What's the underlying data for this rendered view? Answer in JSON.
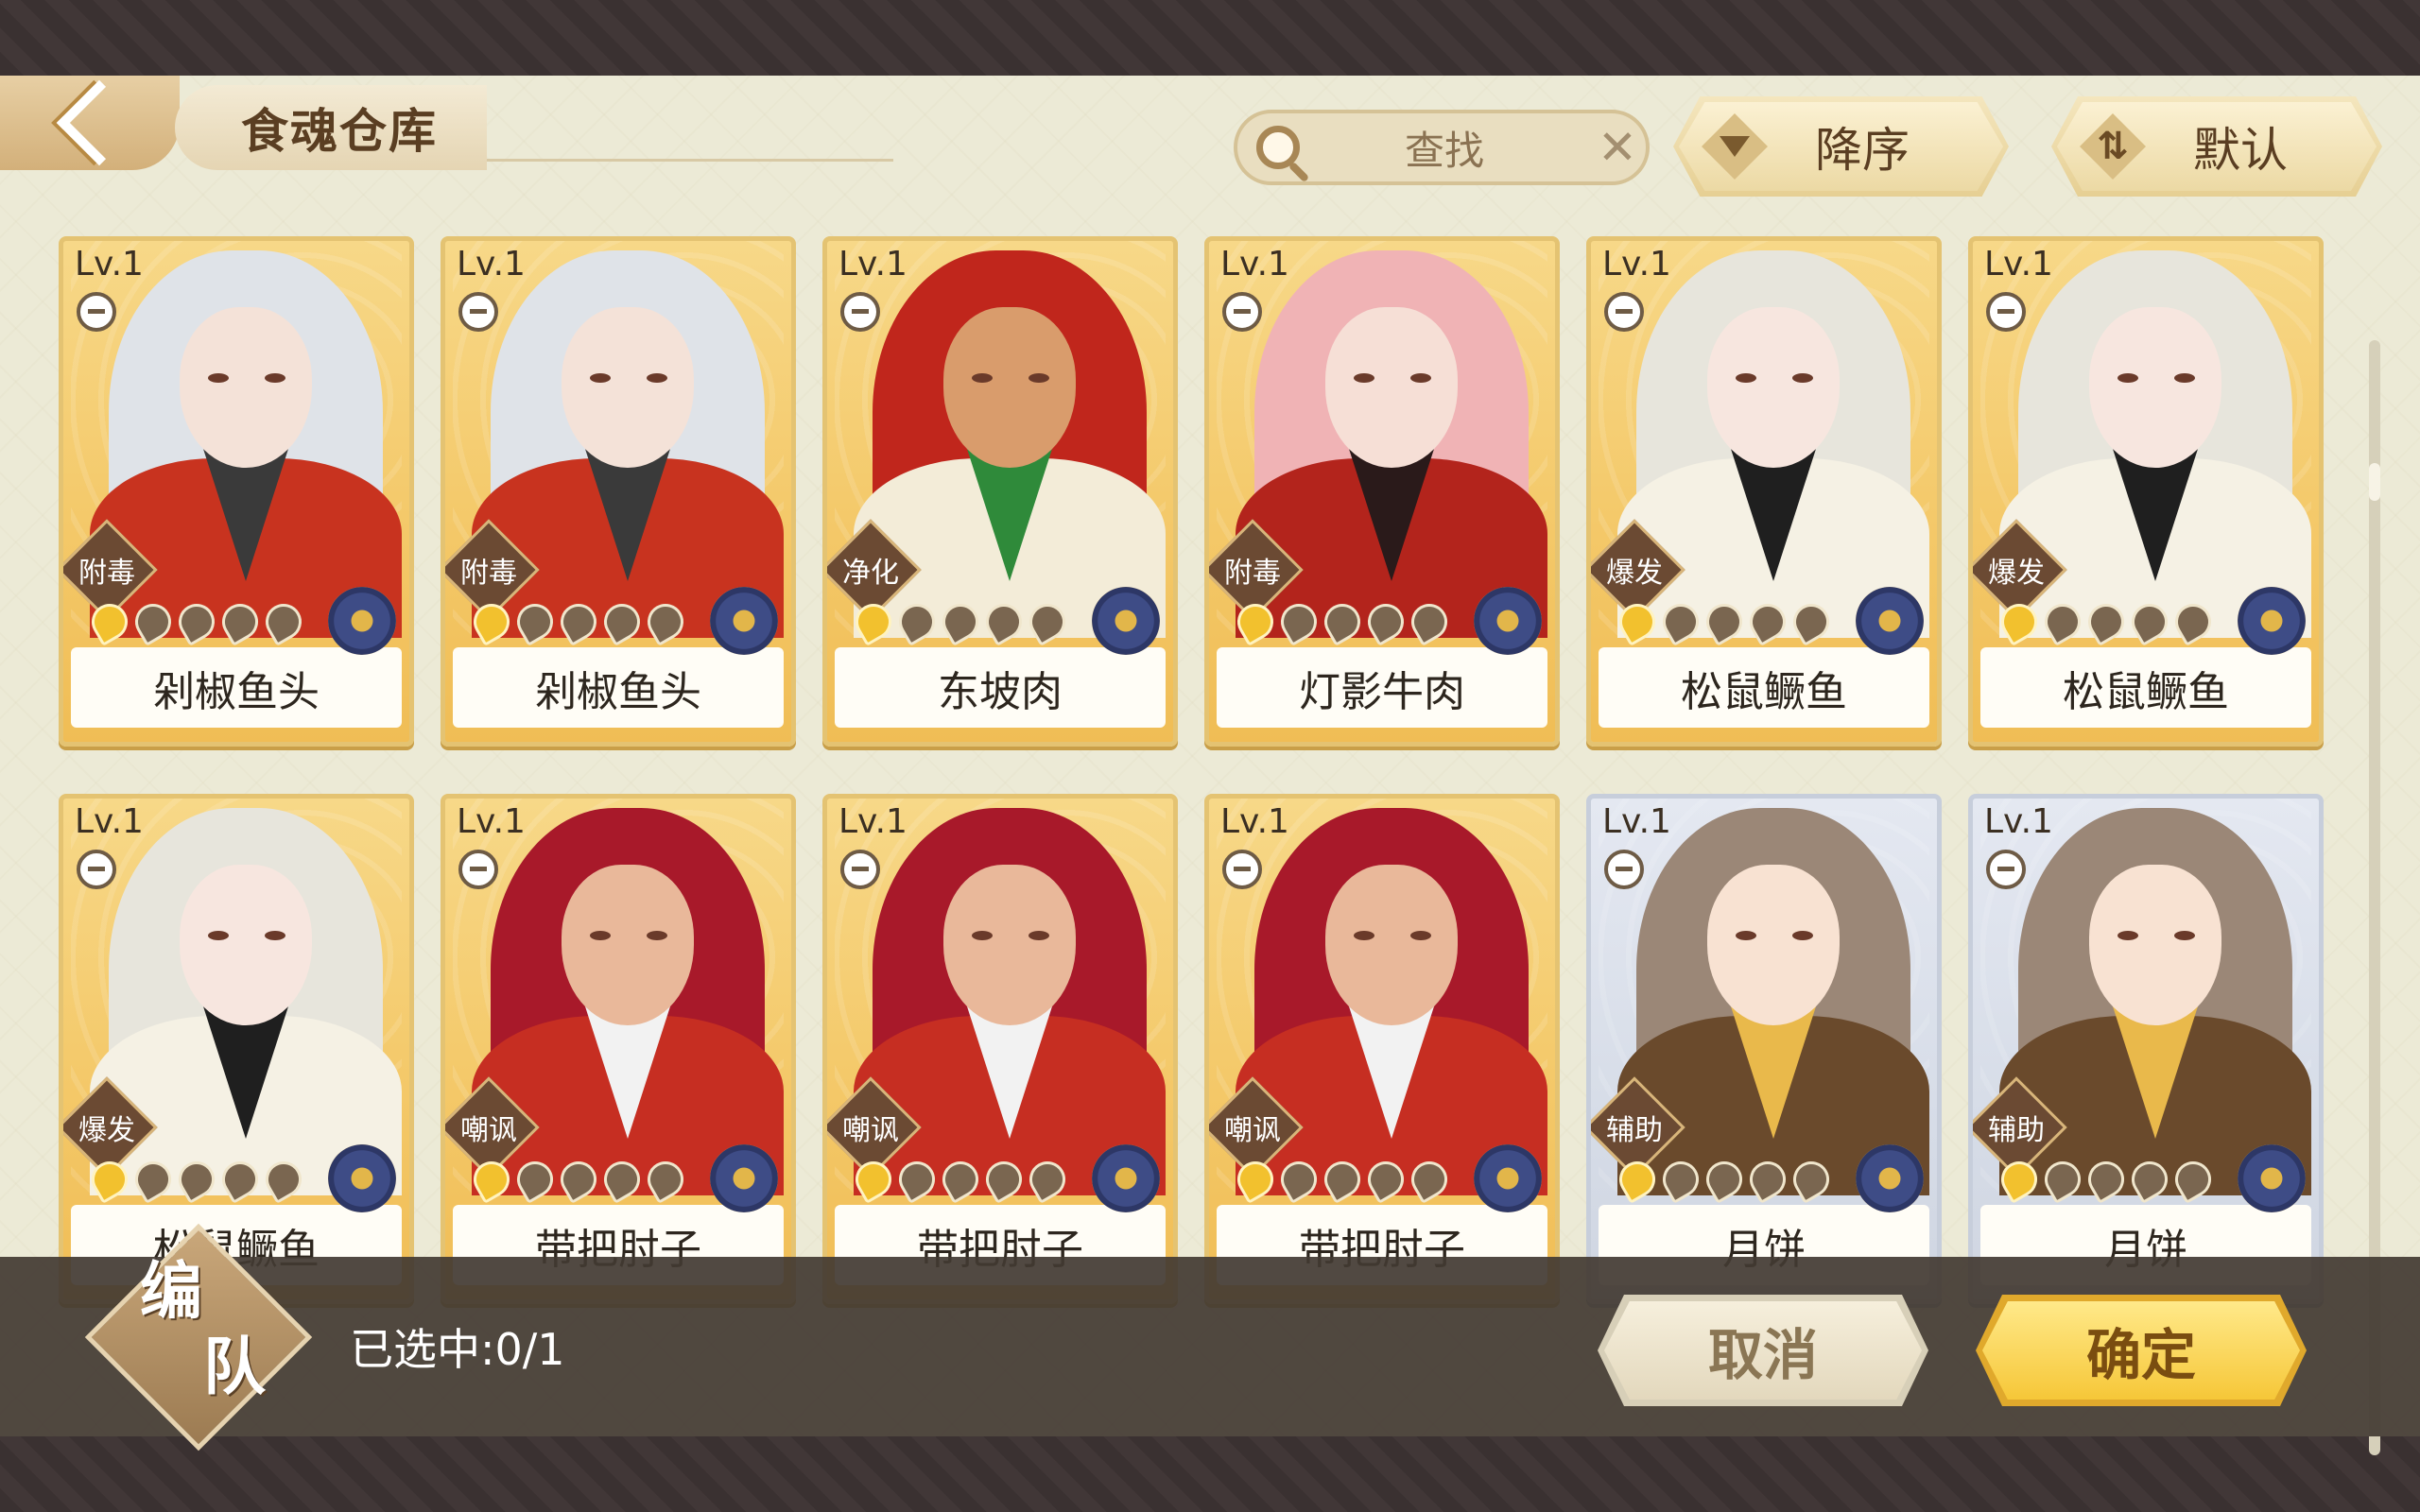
{
  "header": {
    "title": "食魂仓库",
    "search_placeholder": "查找",
    "sort_order_label": "降序",
    "sort_mode_label": "默认"
  },
  "cards": [
    {
      "level": "Lv.1",
      "tag": "附毒",
      "name": "剁椒鱼头",
      "stars_lit": 1,
      "frame": "gold",
      "theme": "duojiao"
    },
    {
      "level": "Lv.1",
      "tag": "附毒",
      "name": "剁椒鱼头",
      "stars_lit": 1,
      "frame": "gold",
      "theme": "duojiao"
    },
    {
      "level": "Lv.1",
      "tag": "净化",
      "name": "东坡肉",
      "stars_lit": 1,
      "frame": "gold",
      "theme": "dongpo"
    },
    {
      "level": "Lv.1",
      "tag": "附毒",
      "name": "灯影牛肉",
      "stars_lit": 1,
      "frame": "gold",
      "theme": "dengying"
    },
    {
      "level": "Lv.1",
      "tag": "爆发",
      "name": "松鼠鳜鱼",
      "stars_lit": 1,
      "frame": "gold",
      "theme": "songshu"
    },
    {
      "level": "Lv.1",
      "tag": "爆发",
      "name": "松鼠鳜鱼",
      "stars_lit": 1,
      "frame": "gold",
      "theme": "songshu"
    },
    {
      "level": "Lv.1",
      "tag": "爆发",
      "name": "松鼠鳜鱼",
      "stars_lit": 1,
      "frame": "gold",
      "theme": "songshu"
    },
    {
      "level": "Lv.1",
      "tag": "嘲讽",
      "name": "带把肘子",
      "stars_lit": 1,
      "frame": "gold",
      "theme": "zhouzi"
    },
    {
      "level": "Lv.1",
      "tag": "嘲讽",
      "name": "带把肘子",
      "stars_lit": 1,
      "frame": "gold",
      "theme": "zhouzi"
    },
    {
      "level": "Lv.1",
      "tag": "嘲讽",
      "name": "带把肘子",
      "stars_lit": 1,
      "frame": "gold",
      "theme": "zhouzi"
    },
    {
      "level": "Lv.1",
      "tag": "辅助",
      "name": "月饼",
      "stars_lit": 1,
      "frame": "blue",
      "theme": "yuebing"
    },
    {
      "level": "Lv.1",
      "tag": "辅助",
      "name": "月饼",
      "stars_lit": 1,
      "frame": "blue",
      "theme": "yuebing"
    }
  ],
  "footer": {
    "team_label_1": "编",
    "team_label_2": "队",
    "selected_text": "已选中:0/1",
    "cancel_label": "取消",
    "confirm_label": "确定"
  },
  "colors": {
    "frame_gold": "#e4c372",
    "frame_blue": "#c7cedb",
    "confirm": "#f6c738",
    "panel_bg": "#ecead6"
  },
  "icons": {
    "back": "back-arrow-icon",
    "search": "magnifier-icon",
    "clear": "close-icon",
    "sort_order": "triangle-down-icon",
    "sort_mode": "swap-arrows-icon"
  }
}
